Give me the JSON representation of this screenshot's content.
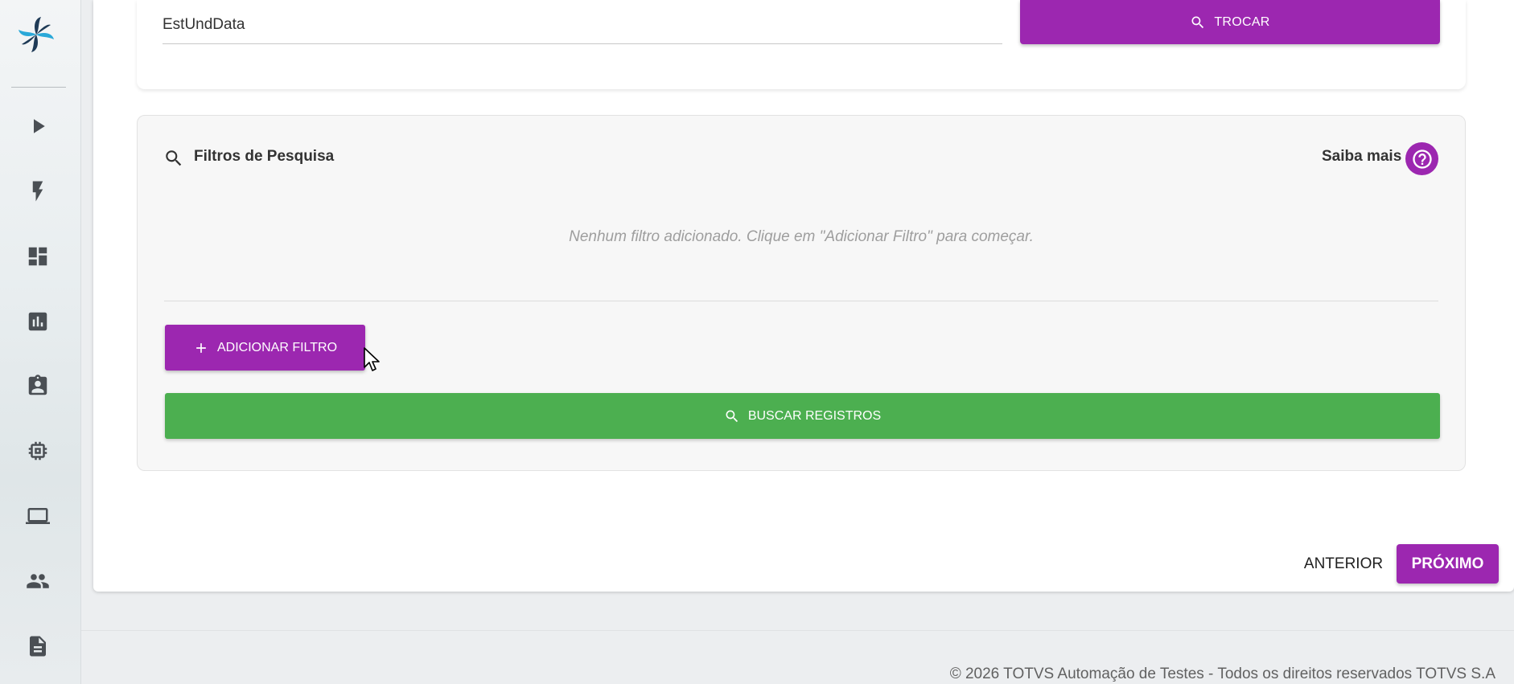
{
  "sidebar": {
    "logo_icon": "pinwheel-logo-icon",
    "items": [
      {
        "name": "play-icon"
      },
      {
        "name": "lightning-icon"
      },
      {
        "name": "dashboard-icon"
      },
      {
        "name": "bar-chart-icon"
      },
      {
        "name": "clipboard-user-icon"
      },
      {
        "name": "chip-icon"
      },
      {
        "name": "laptop-icon"
      },
      {
        "name": "people-icon"
      },
      {
        "name": "document-icon"
      }
    ]
  },
  "table_field": {
    "value": "EstUndData"
  },
  "trocar_button": {
    "label": "TROCAR",
    "icon": "search-icon"
  },
  "filters": {
    "title": "Filtros de Pesquisa",
    "help_label": "Saiba mais",
    "empty_message": "Nenhum filtro adicionado. Clique em \"Adicionar Filtro\" para começar.",
    "add_button_label": "ADICIONAR FILTRO",
    "search_button_label": "BUSCAR REGISTROS"
  },
  "navigation": {
    "previous_label": "ANTERIOR",
    "next_label": "PRÓXIMO"
  },
  "footer": {
    "text": "© 2026 TOTVS Automação de Testes - Todos os direitos reservados TOTVS S.A"
  },
  "colors": {
    "primary": "#9c27b0",
    "success": "#4caf50"
  }
}
